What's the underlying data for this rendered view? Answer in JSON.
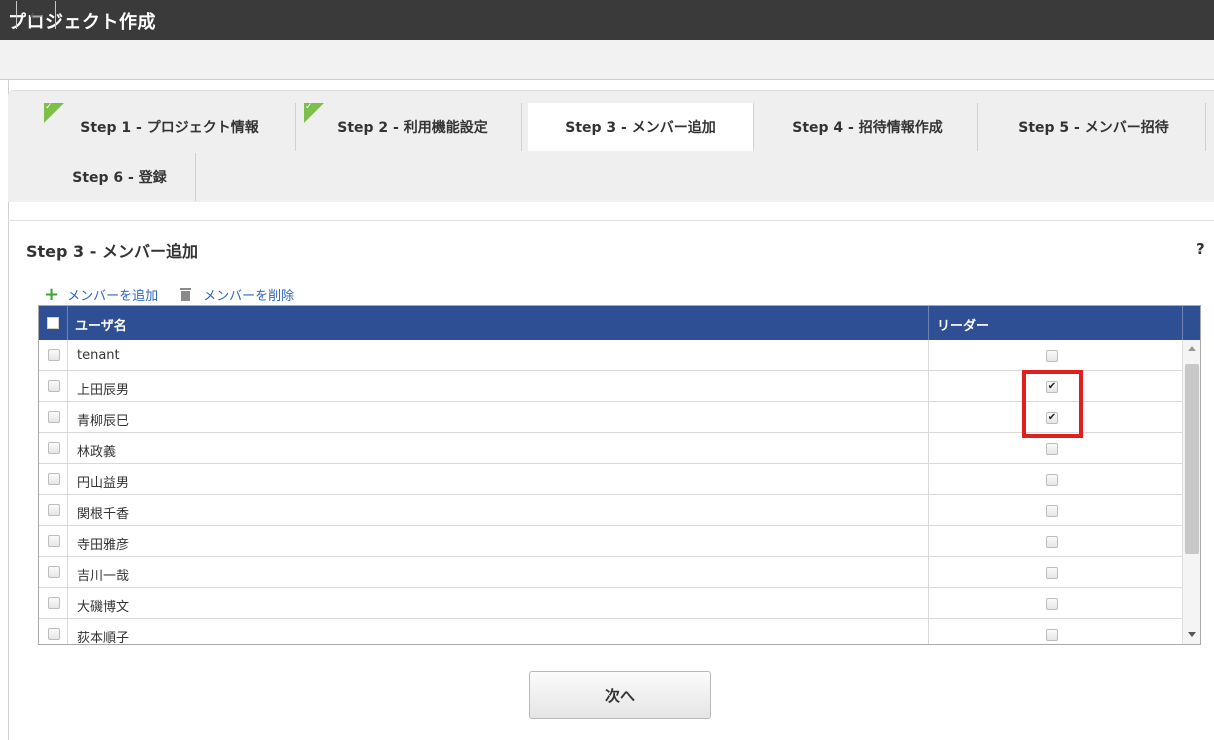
{
  "window": {
    "title": "プロジェクト作成"
  },
  "toolbar": {
    "back_icon": "←"
  },
  "steps": [
    {
      "label": "Step 1 - プロジェクト情報",
      "state": "done"
    },
    {
      "label": "Step 2 - 利用機能設定",
      "state": "done"
    },
    {
      "label": "Step 3 - メンバー追加",
      "state": "active"
    },
    {
      "label": "Step 4 - 招待情報作成",
      "state": "pending"
    },
    {
      "label": "Step 5 - メンバー招待",
      "state": "pending"
    },
    {
      "label": "Step 6 - 登録",
      "state": "pending"
    }
  ],
  "section": {
    "title": "Step 3 - メンバー追加",
    "help": "?"
  },
  "actions": {
    "add_label": "メンバーを追加",
    "add_icon": "+",
    "delete_label": "メンバーを削除"
  },
  "grid": {
    "header": {
      "name": "ユーザ名",
      "leader": "リーダー"
    },
    "rows": [
      {
        "name": "tenant",
        "leader": false
      },
      {
        "name": "上田辰男",
        "leader": true
      },
      {
        "name": "青柳辰巳",
        "leader": true
      },
      {
        "name": "林政義",
        "leader": false
      },
      {
        "name": "円山益男",
        "leader": false
      },
      {
        "name": "関根千香",
        "leader": false
      },
      {
        "name": "寺田雅彦",
        "leader": false
      },
      {
        "name": "吉川一哉",
        "leader": false
      },
      {
        "name": "大磯博文",
        "leader": false
      },
      {
        "name": "荻本順子",
        "leader": false
      }
    ],
    "check_mark": "✔"
  },
  "colors": {
    "header_bg": "#2f4f94",
    "titlebar_bg": "#3a3a3a",
    "highlight": "#e02020",
    "done_check": "#7cc04a",
    "link": "#2d64c0"
  },
  "footer": {
    "next_label": "次へ"
  }
}
